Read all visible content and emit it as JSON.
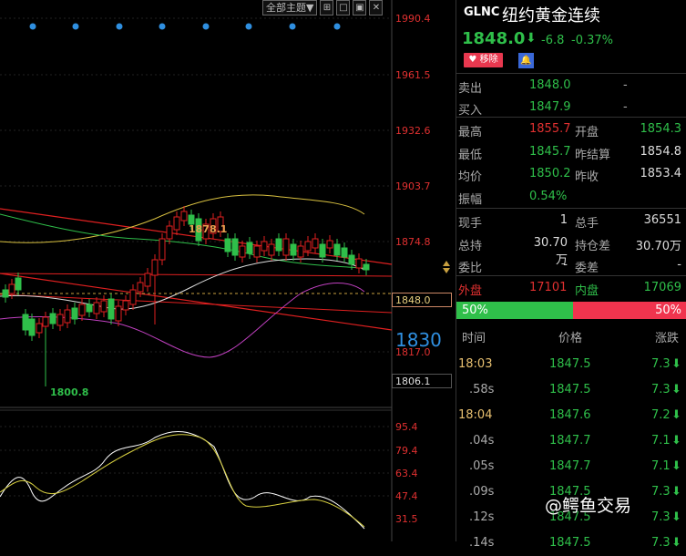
{
  "toolbar": {
    "theme_label": "全部主题▼",
    "icons": [
      "grid-icon",
      "square-icon",
      "window-icon",
      "close-icon"
    ]
  },
  "price_axis": [
    "1990.4",
    "1961.5",
    "1932.6",
    "1903.7",
    "1874.8",
    "1817.0"
  ],
  "current_price_box": "1848.0",
  "low_price_box": "1806.1",
  "level_1830": "1830",
  "annotations": {
    "high": "1878.1",
    "low": "1800.8"
  },
  "indicator_axis": [
    "95.4",
    "79.4",
    "63.4",
    "47.4",
    "31.5"
  ],
  "quote": {
    "symbol": "GLNC",
    "name": "纽约黄金连续",
    "price": "1848.0",
    "arrow": "⬇",
    "change": "-6.8",
    "change_pct": "-0.37%",
    "remove_label": "♥ 移除",
    "bell": "🔔"
  },
  "bid_ask": [
    {
      "label": "卖出",
      "value": "1848.0",
      "extra": "-"
    },
    {
      "label": "买入",
      "value": "1847.9",
      "extra": "-"
    }
  ],
  "stats": [
    {
      "l1": "最高",
      "v1": "1855.7",
      "c1": "#e03030",
      "l2": "开盘",
      "v2": "1854.3",
      "c2": "#2fbf4a"
    },
    {
      "l1": "最低",
      "v1": "1845.7",
      "c1": "#2fbf4a",
      "l2": "昨结算",
      "v2": "1854.8",
      "c2": "#ddd"
    },
    {
      "l1": "均价",
      "v1": "1850.2",
      "c1": "#2fbf4a",
      "l2": "昨收",
      "v2": "1853.4",
      "c2": "#ddd"
    },
    {
      "l1": "振幅",
      "v1": "0.54%",
      "c1": "#2fbf4a",
      "l2": "",
      "v2": "",
      "c2": "#ddd"
    }
  ],
  "volume": [
    {
      "l1": "现手",
      "v1": "1",
      "l2": "总手",
      "v2": "36551"
    },
    {
      "l1": "总持",
      "v1": "30.70万",
      "l2": "持仓差",
      "v2": "30.70万"
    },
    {
      "l1": "委比",
      "v1": "-",
      "l2": "委差",
      "v2": "-"
    }
  ],
  "outer_inner": {
    "l1": "外盘",
    "v1": "17101",
    "l2": "内盘",
    "v2": "17069"
  },
  "ratio": {
    "buy": "50%",
    "sell": "50%",
    "buy_color": "#2fbf4a",
    "sell_color": "#f0344e"
  },
  "ticks_header": {
    "time": "时间",
    "price": "价格",
    "change": "涨跌"
  },
  "ticks": [
    {
      "time": "18:03",
      "price": "1847.5",
      "chg": "7.3",
      "time_color": "#e8c070"
    },
    {
      "time": ".58s",
      "price": "1847.5",
      "chg": "7.3",
      "time_color": "#aaa"
    },
    {
      "time": "18:04",
      "price": "1847.6",
      "chg": "7.2",
      "time_color": "#e8c070"
    },
    {
      "time": ".04s",
      "price": "1847.7",
      "chg": "7.1",
      "time_color": "#aaa"
    },
    {
      "time": ".05s",
      "price": "1847.7",
      "chg": "7.1",
      "time_color": "#aaa"
    },
    {
      "time": ".09s",
      "price": "1847.5",
      "chg": "7.3",
      "time_color": "#aaa"
    },
    {
      "time": ".12s",
      "price": "1847.5",
      "chg": "7.3",
      "time_color": "#aaa"
    },
    {
      "time": ".14s",
      "price": "1847.5",
      "chg": "7.3",
      "time_color": "#aaa"
    }
  ],
  "watermark": "@鳄鱼交易"
}
